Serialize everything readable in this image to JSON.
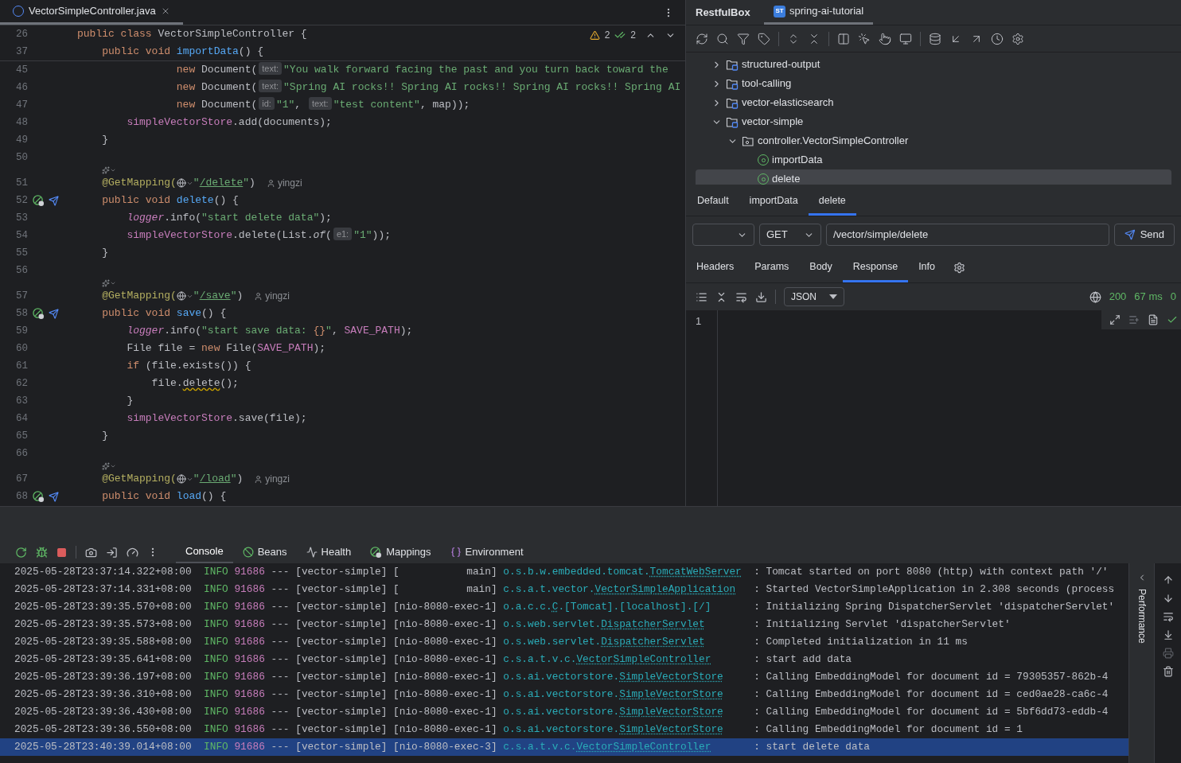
{
  "editor": {
    "tab": {
      "title": "VectorSimpleController.java",
      "selected": true
    },
    "inspections": {
      "warnings": "2",
      "checks": "2"
    },
    "sticky_lines": [
      {
        "n": "26",
        "kind": "top",
        "tokens": [
          {
            "kind": "kw",
            "text": "public class "
          },
          {
            "kind": "plain",
            "text": "VectorSimpleController {"
          }
        ]
      },
      {
        "n": "37",
        "kind": "member",
        "tokens": [
          {
            "kind": "kw",
            "text": "public void "
          },
          {
            "kind": "fn",
            "text": "importData"
          },
          {
            "kind": "plain",
            "text": "() {"
          }
        ]
      }
    ],
    "lines": [
      {
        "n": "45",
        "kind": "argument",
        "tokens": [
          {
            "kind": "kw",
            "text": "new "
          },
          {
            "kind": "plain",
            "text": "Document("
          },
          {
            "kind": "hint",
            "text": "text:"
          },
          {
            "kind": "str",
            "text": "\"You walk forward facing the past and you turn back toward the"
          }
        ]
      },
      {
        "n": "46",
        "kind": "argument",
        "tokens": [
          {
            "kind": "kw",
            "text": "new "
          },
          {
            "kind": "plain",
            "text": "Document("
          },
          {
            "kind": "hint",
            "text": "text:"
          },
          {
            "kind": "str",
            "text": "\"Spring AI rocks!! Spring AI rocks!! Spring AI rocks!! Spring AI"
          }
        ]
      },
      {
        "n": "47",
        "kind": "argument",
        "tokens": [
          {
            "kind": "kw",
            "text": "new "
          },
          {
            "kind": "plain",
            "text": "Document("
          },
          {
            "kind": "hint",
            "text": "id:"
          },
          {
            "kind": "str",
            "text": "\"1\""
          },
          {
            "kind": "plain",
            "text": ", "
          },
          {
            "kind": "hint",
            "text": "text:"
          },
          {
            "kind": "str",
            "text": "\"test content\""
          },
          {
            "kind": "plain",
            "text": ", map));"
          }
        ]
      },
      {
        "n": "48",
        "kind": "statement",
        "tokens": [
          {
            "kind": "field",
            "text": "simpleVectorStore"
          },
          {
            "kind": "plain",
            "text": ".add(documents);"
          }
        ]
      },
      {
        "n": "49",
        "kind": "member",
        "tokens": [
          {
            "kind": "plain",
            "text": "}"
          }
        ]
      },
      {
        "n": "50",
        "kind": "top"
      },
      {
        "n": "51",
        "kind": "member",
        "lens": true,
        "author": "yingzi",
        "tokens": [
          {
            "kind": "ann",
            "text": "@GetMapping("
          },
          {
            "kind": "globe"
          },
          {
            "kind": "str",
            "text": "\""
          },
          {
            "kind": "link",
            "text": "/delete"
          },
          {
            "kind": "str",
            "text": "\""
          },
          {
            "kind": "plain",
            "text": ")"
          }
        ]
      },
      {
        "n": "52",
        "kind": "member",
        "gutter": true,
        "tokens": [
          {
            "kind": "kw",
            "text": "public void "
          },
          {
            "kind": "fn",
            "text": "delete"
          },
          {
            "kind": "plain",
            "text": "() {"
          }
        ]
      },
      {
        "n": "53",
        "kind": "statement",
        "tokens": [
          {
            "kind": "fieldi",
            "text": "logger"
          },
          {
            "kind": "plain",
            "text": ".info("
          },
          {
            "kind": "str",
            "text": "\"start delete data\""
          },
          {
            "kind": "plain",
            "text": ");"
          }
        ]
      },
      {
        "n": "54",
        "kind": "statement",
        "tokens": [
          {
            "kind": "field",
            "text": "simpleVectorStore"
          },
          {
            "kind": "plain",
            "text": ".delete(List."
          },
          {
            "kind": "ital",
            "text": "of"
          },
          {
            "kind": "plain",
            "text": "("
          },
          {
            "kind": "hint",
            "text": "e1:"
          },
          {
            "kind": "str",
            "text": "\"1\""
          },
          {
            "kind": "plain",
            "text": "));"
          }
        ]
      },
      {
        "n": "55",
        "kind": "member",
        "tokens": [
          {
            "kind": "plain",
            "text": "}"
          }
        ]
      },
      {
        "n": "56",
        "kind": "top"
      },
      {
        "n": "57",
        "kind": "member",
        "lens": true,
        "author": "yingzi",
        "tokens": [
          {
            "kind": "ann",
            "text": "@GetMapping("
          },
          {
            "kind": "globe"
          },
          {
            "kind": "str",
            "text": "\""
          },
          {
            "kind": "link",
            "text": "/save"
          },
          {
            "kind": "str",
            "text": "\""
          },
          {
            "kind": "plain",
            "text": ")"
          }
        ]
      },
      {
        "n": "58",
        "kind": "member",
        "gutter": true,
        "tokens": [
          {
            "kind": "kw",
            "text": "public void "
          },
          {
            "kind": "fn",
            "text": "save"
          },
          {
            "kind": "plain",
            "text": "() {"
          }
        ]
      },
      {
        "n": "59",
        "kind": "statement",
        "tokens": [
          {
            "kind": "fieldi",
            "text": "logger"
          },
          {
            "kind": "plain",
            "text": ".info("
          },
          {
            "kind": "str",
            "text": "\"start save data: "
          },
          {
            "kind": "kw",
            "text": "{}"
          },
          {
            "kind": "str",
            "text": "\""
          },
          {
            "kind": "plain",
            "text": ", "
          },
          {
            "kind": "field",
            "text": "SAVE_PATH"
          },
          {
            "kind": "plain",
            "text": ");"
          }
        ]
      },
      {
        "n": "60",
        "kind": "statement",
        "tokens": [
          {
            "kind": "plain",
            "text": "File file = "
          },
          {
            "kind": "kw",
            "text": "new "
          },
          {
            "kind": "plain",
            "text": "File("
          },
          {
            "kind": "field",
            "text": "SAVE_PATH"
          },
          {
            "kind": "plain",
            "text": ");"
          }
        ]
      },
      {
        "n": "61",
        "kind": "statement",
        "tokens": [
          {
            "kind": "kw",
            "text": "if "
          },
          {
            "kind": "plain",
            "text": "(file.exists()) {"
          }
        ]
      },
      {
        "n": "62",
        "kind": "nested",
        "tokens": [
          {
            "kind": "plain",
            "text": "file."
          },
          {
            "kind": "warn",
            "text": "delete"
          },
          {
            "kind": "plain",
            "text": "();"
          }
        ]
      },
      {
        "n": "63",
        "kind": "statement",
        "tokens": [
          {
            "kind": "plain",
            "text": "}"
          }
        ]
      },
      {
        "n": "64",
        "kind": "statement",
        "tokens": [
          {
            "kind": "field",
            "text": "simpleVectorStore"
          },
          {
            "kind": "plain",
            "text": ".save(file);"
          }
        ]
      },
      {
        "n": "65",
        "kind": "member",
        "tokens": [
          {
            "kind": "plain",
            "text": "}"
          }
        ]
      },
      {
        "n": "66",
        "kind": "top"
      },
      {
        "n": "67",
        "kind": "member",
        "lens": true,
        "author": "yingzi",
        "tokens": [
          {
            "kind": "ann",
            "text": "@GetMapping("
          },
          {
            "kind": "globe"
          },
          {
            "kind": "str",
            "text": "\""
          },
          {
            "kind": "link",
            "text": "/load"
          },
          {
            "kind": "str",
            "text": "\""
          },
          {
            "kind": "plain",
            "text": ")"
          }
        ]
      },
      {
        "n": "68",
        "kind": "member",
        "gutter": true,
        "tokens": [
          {
            "kind": "kw",
            "text": "public void "
          },
          {
            "kind": "fn",
            "text": "load"
          },
          {
            "kind": "plain",
            "text": "() {"
          }
        ]
      }
    ]
  },
  "restful_box": {
    "title": "RestfulBox",
    "project_tab": {
      "badge": "ST",
      "label": "spring-ai-tutorial",
      "selected": true
    },
    "tree": [
      {
        "label": "structured-output",
        "kind": "module",
        "expanded": false,
        "selected": false
      },
      {
        "label": "tool-calling",
        "kind": "module",
        "expanded": false,
        "selected": false
      },
      {
        "label": "vector-elasticsearch",
        "kind": "module",
        "expanded": false,
        "selected": false
      },
      {
        "label": "vector-simple",
        "kind": "module",
        "expanded": true,
        "selected": false,
        "children": [
          {
            "label": "controller.VectorSimpleController",
            "kind": "class",
            "expanded": true,
            "selected": false,
            "children": [
              {
                "label": "importData",
                "kind": "method",
                "selected": false
              },
              {
                "label": "delete",
                "kind": "method",
                "selected": true
              }
            ]
          }
        ]
      }
    ],
    "request_tabs": [
      {
        "label": "Default",
        "selected": false
      },
      {
        "label": "importData",
        "selected": false
      },
      {
        "label": "delete",
        "selected": true
      }
    ],
    "request": {
      "method": "GET",
      "url": "/vector/simple/delete",
      "send": "Send"
    },
    "detail_tabs": [
      {
        "label": "Headers",
        "selected": false
      },
      {
        "label": "Params",
        "selected": false
      },
      {
        "label": "Body",
        "selected": false
      },
      {
        "label": "Response",
        "selected": true
      },
      {
        "label": "Info",
        "selected": false
      }
    ],
    "response": {
      "format": "JSON",
      "status": "200",
      "time": "67 ms",
      "size": "0",
      "line_numbers": [
        "1"
      ]
    }
  },
  "services": {
    "tabs": [
      {
        "label": "Console",
        "selected": true
      },
      {
        "label": "Beans",
        "selected": false
      },
      {
        "label": "Health",
        "selected": false
      },
      {
        "label": "Mappings",
        "selected": false
      },
      {
        "label": "Environment",
        "selected": false
      }
    ],
    "side_label": "Performance",
    "console": [
      {
        "time": "2025-05-28T23:37:14.322+08:00",
        "level": "INFO",
        "pid": "91686",
        "sep": "---",
        "app": "[vector-simple]",
        "thread": "[           main]",
        "logger_pkg": "o.s.b.w.embedded.tomcat.",
        "logger_class": "TomcatWebServer",
        "message": ": Tomcat started on port 8080 (http) with context path '/'",
        "selected": false
      },
      {
        "time": "2025-05-28T23:37:14.331+08:00",
        "level": "INFO",
        "pid": "91686",
        "sep": "---",
        "app": "[vector-simple]",
        "thread": "[           main]",
        "logger_pkg": "c.s.a.t.vector.",
        "logger_class": "VectorSimpleApplication",
        "message": ": Started VectorSimpleApplication in 2.308 seconds (process",
        "selected": false
      },
      {
        "time": "2025-05-28T23:39:35.570+08:00",
        "level": "INFO",
        "pid": "91686",
        "sep": "---",
        "app": "[vector-simple]",
        "thread": "[nio-8080-exec-1]",
        "logger_pkg": "o.a.c.c.",
        "logger_class": "C",
        "logger_rest": ".[Tomcat].[localhost].[/]",
        "message": ": Initializing Spring DispatcherServlet 'dispatcherServlet'",
        "selected": false
      },
      {
        "time": "2025-05-28T23:39:35.573+08:00",
        "level": "INFO",
        "pid": "91686",
        "sep": "---",
        "app": "[vector-simple]",
        "thread": "[nio-8080-exec-1]",
        "logger_pkg": "o.s.web.servlet.",
        "logger_class": "DispatcherServlet",
        "message": ": Initializing Servlet 'dispatcherServlet'",
        "selected": false
      },
      {
        "time": "2025-05-28T23:39:35.588+08:00",
        "level": "INFO",
        "pid": "91686",
        "sep": "---",
        "app": "[vector-simple]",
        "thread": "[nio-8080-exec-1]",
        "logger_pkg": "o.s.web.servlet.",
        "logger_class": "DispatcherServlet",
        "message": ": Completed initialization in 11 ms",
        "selected": false
      },
      {
        "time": "2025-05-28T23:39:35.641+08:00",
        "level": "INFO",
        "pid": "91686",
        "sep": "---",
        "app": "[vector-simple]",
        "thread": "[nio-8080-exec-1]",
        "logger_pkg": "c.s.a.t.v.c.",
        "logger_class": "VectorSimpleController",
        "message": ": start add data",
        "selected": false
      },
      {
        "time": "2025-05-28T23:39:36.197+08:00",
        "level": "INFO",
        "pid": "91686",
        "sep": "---",
        "app": "[vector-simple]",
        "thread": "[nio-8080-exec-1]",
        "logger_pkg": "o.s.ai.vectorstore.",
        "logger_class": "SimpleVectorStore",
        "message": ": Calling EmbeddingModel for document id = 79305357-862b-4",
        "selected": false
      },
      {
        "time": "2025-05-28T23:39:36.310+08:00",
        "level": "INFO",
        "pid": "91686",
        "sep": "---",
        "app": "[vector-simple]",
        "thread": "[nio-8080-exec-1]",
        "logger_pkg": "o.s.ai.vectorstore.",
        "logger_class": "SimpleVectorStore",
        "message": ": Calling EmbeddingModel for document id = ced0ae28-ca6c-4",
        "selected": false
      },
      {
        "time": "2025-05-28T23:39:36.430+08:00",
        "level": "INFO",
        "pid": "91686",
        "sep": "---",
        "app": "[vector-simple]",
        "thread": "[nio-8080-exec-1]",
        "logger_pkg": "o.s.ai.vectorstore.",
        "logger_class": "SimpleVectorStore",
        "message": ": Calling EmbeddingModel for document id = 5bf6dd73-eddb-4",
        "selected": false
      },
      {
        "time": "2025-05-28T23:39:36.550+08:00",
        "level": "INFO",
        "pid": "91686",
        "sep": "---",
        "app": "[vector-simple]",
        "thread": "[nio-8080-exec-1]",
        "logger_pkg": "o.s.ai.vectorstore.",
        "logger_class": "SimpleVectorStore",
        "message": ": Calling EmbeddingModel for document id = 1",
        "selected": false
      },
      {
        "time": "2025-05-28T23:40:39.014+08:00",
        "level": "INFO",
        "pid": "91686",
        "sep": "---",
        "app": "[vector-simple]",
        "thread": "[nio-8080-exec-3]",
        "logger_pkg": "c.s.a.t.v.c.",
        "logger_class": "VectorSimpleController",
        "message": ": start delete data",
        "selected": true
      }
    ]
  }
}
